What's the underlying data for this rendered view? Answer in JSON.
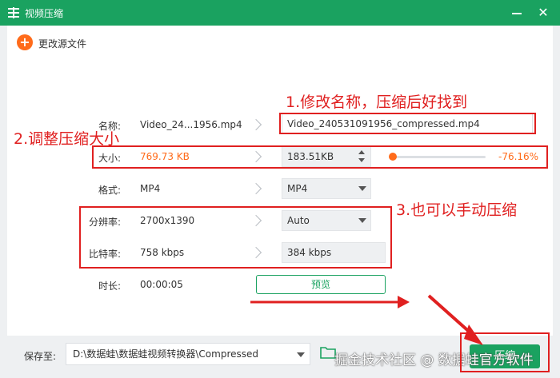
{
  "window": {
    "title": "视频压缩",
    "close_glyph": "✕"
  },
  "toolbar": {
    "change_source_label": "更改源文件",
    "plus_glyph": "+"
  },
  "form": {
    "name": {
      "label": "名称:",
      "source": "Video_24...1956.mp4",
      "output": "Video_240531091956_compressed.mp4"
    },
    "size": {
      "label": "大小:",
      "source": "769.73 KB",
      "output": "183.51KB",
      "percent": "-76.16%",
      "slider_level": 0.0
    },
    "format": {
      "label": "格式:",
      "source": "MP4",
      "output": "MP4"
    },
    "resolution": {
      "label": "分辨率:",
      "source": "2700x1390",
      "output": "Auto"
    },
    "bitrate": {
      "label": "比特率:",
      "source": "758 kbps",
      "output": "384 kbps"
    },
    "duration": {
      "label": "时长:",
      "source": "00:00:05",
      "preview_label": "预览"
    }
  },
  "annotations": {
    "a1": "1.修改名称，压缩后好找到",
    "a2": "2.调整压缩大小",
    "a3": "3.也可以手动压缩"
  },
  "bottom": {
    "save_label": "保存至:",
    "save_path": "D:\\数据蛙\\数据蛙视频转换器\\Compressed",
    "compress_label": "压缩",
    "watermark": "掘金技术社区 @ 数据蛙官方软件"
  },
  "colors": {
    "brand": "#1aa260",
    "accent": "#ff6b1a",
    "annotation": "#e02020"
  },
  "icons": [
    "app-menu-icon",
    "minimize-icon",
    "close-icon",
    "plus-icon",
    "chevron-right-icon",
    "dropdown-arrow-icon",
    "spinner-up-icon",
    "spinner-down-icon",
    "folder-icon"
  ]
}
